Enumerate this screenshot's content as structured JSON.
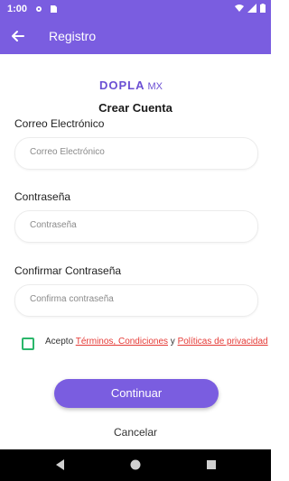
{
  "status_bar": {
    "time": "1:00"
  },
  "app_bar": {
    "title": "Registro"
  },
  "logo": {
    "name": "DOPLA",
    "country": "MX"
  },
  "heading": "Crear Cuenta",
  "email": {
    "label": "Correo Electrónico",
    "placeholder": "Correo Electrónico"
  },
  "password": {
    "label": "Contraseña",
    "placeholder": "Contraseña"
  },
  "confirm": {
    "label": "Confirmar Contraseña",
    "placeholder": "Confirma contraseña"
  },
  "terms": {
    "prefix": "Acepto ",
    "link1": "Términos, Condiciones",
    "connector": " y ",
    "link2": "Políticas de privacidad"
  },
  "buttons": {
    "continue": "Continuar",
    "cancel": "Cancelar"
  },
  "colors": {
    "primary": "#7a5de0",
    "checkbox": "#2bb66b",
    "link": "#e53935"
  }
}
